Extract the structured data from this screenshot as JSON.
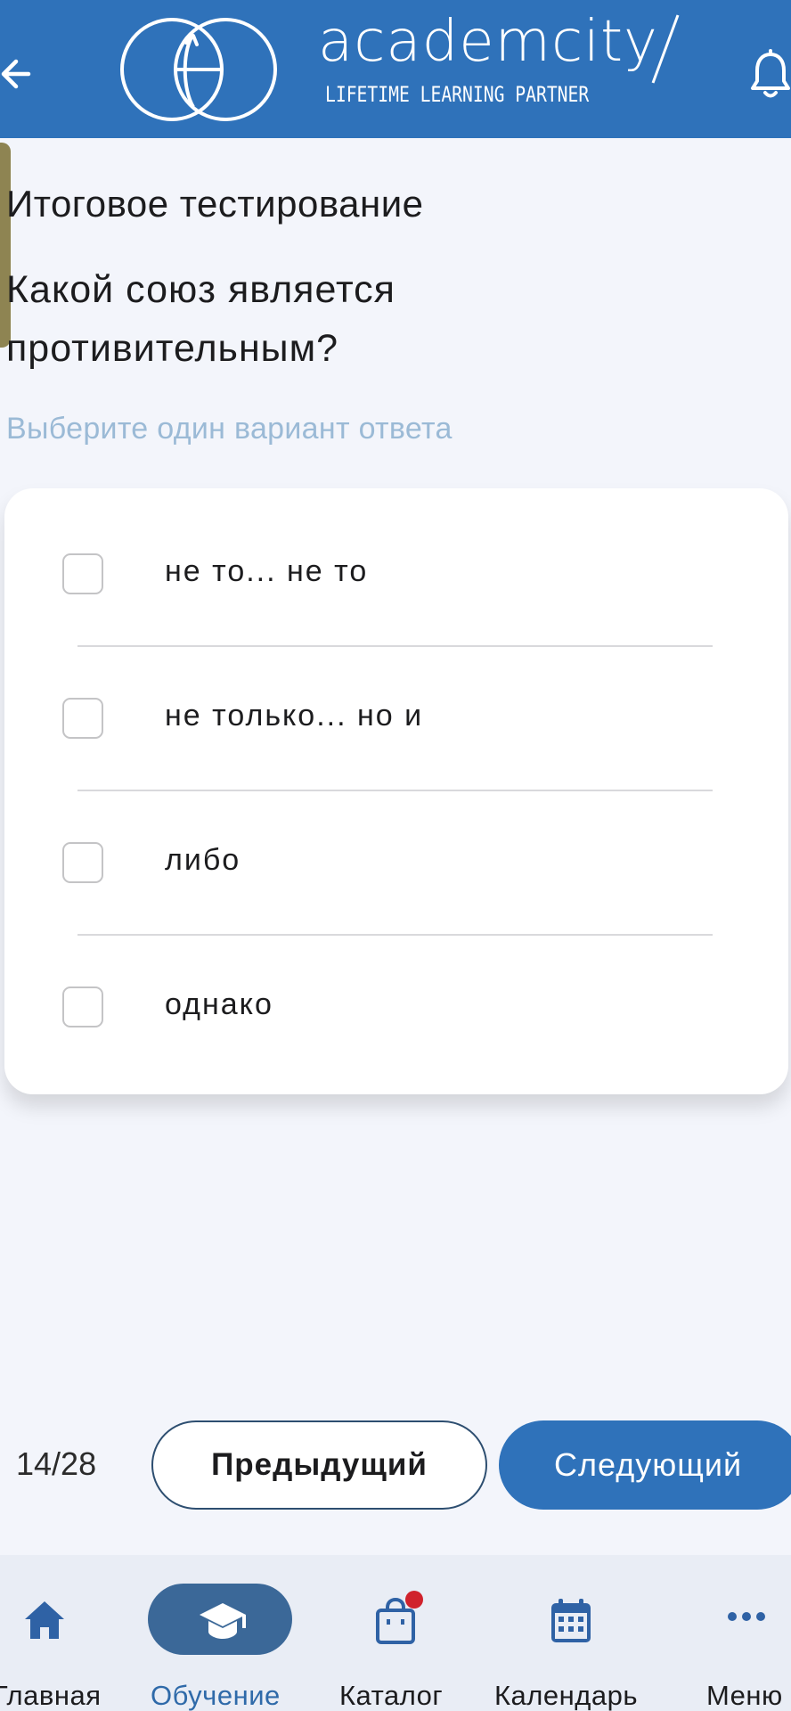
{
  "header": {
    "brand_name": "academcity",
    "brand_tagline": "LIFETIME LEARNING PARTNER",
    "back_icon": "arrow-left-icon",
    "notifications_icon": "bell-icon"
  },
  "test": {
    "title": "Итоговое тестирование",
    "question": "Какой союз является противительным?",
    "hint": "Выберите один вариант ответа",
    "options": [
      {
        "label": "не то... не то",
        "checked": false
      },
      {
        "label": "не только... но и",
        "checked": false
      },
      {
        "label": "либо",
        "checked": false
      },
      {
        "label": "однако",
        "checked": false
      }
    ]
  },
  "pager": {
    "counter": "14/28",
    "prev_label": "Предыдущий",
    "next_label": "Следующий"
  },
  "bottom_nav": {
    "items": [
      {
        "label": "Главная",
        "icon": "home-icon",
        "active": false
      },
      {
        "label": "Обучение",
        "icon": "graduation-cap-icon",
        "active": true
      },
      {
        "label": "Каталог",
        "icon": "shopping-bag-icon",
        "active": false,
        "badge": true
      },
      {
        "label": "Календарь",
        "icon": "calendar-icon",
        "active": false
      },
      {
        "label": "Меню",
        "icon": "more-dots-icon",
        "active": false
      }
    ]
  },
  "colors": {
    "brand_blue": "#2f72ba",
    "nav_active_pill": "#3b6898",
    "hint_text": "#9bbad6",
    "badge_red": "#d0222c"
  }
}
